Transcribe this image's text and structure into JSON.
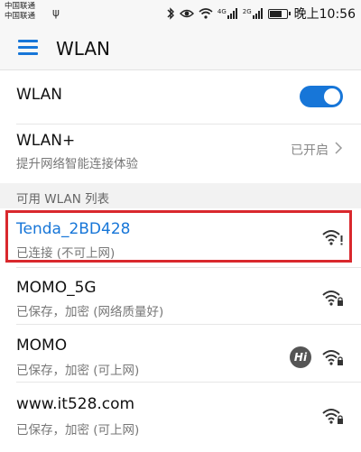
{
  "status_bar": {
    "carrier_1": "中国联通",
    "carrier_2": "中国联通",
    "signal_label_1": "4G",
    "signal_label_2": "2G",
    "battery_percent": 75,
    "time": "晚上10:56"
  },
  "header": {
    "title": "WLAN"
  },
  "wlan_toggle": {
    "label": "WLAN",
    "enabled": true
  },
  "wlan_plus": {
    "title": "WLAN+",
    "subtitle": "提升网络智能连接体验",
    "status": "已开启"
  },
  "network_list": {
    "header": "可用 WLAN 列表",
    "items": [
      {
        "ssid": "Tenda_2BD428",
        "status": "已连接 (不可上网)",
        "icon": "wifi-no-internet-icon",
        "connected": true
      },
      {
        "ssid": "MOMO_5G",
        "status": "已保存，加密 (网络质量好)",
        "icon": "wifi-lock-icon"
      },
      {
        "ssid": "MOMO",
        "status": "已保存，加密 (可上网)",
        "icon": "wifi-lock-icon",
        "badge": "Hi"
      },
      {
        "ssid": "www.it528.com",
        "status": "已保存，加密 (可上网)",
        "icon": "wifi-lock-icon"
      }
    ]
  },
  "colors": {
    "accent": "#1776d8",
    "highlight_border": "#d9282d"
  }
}
